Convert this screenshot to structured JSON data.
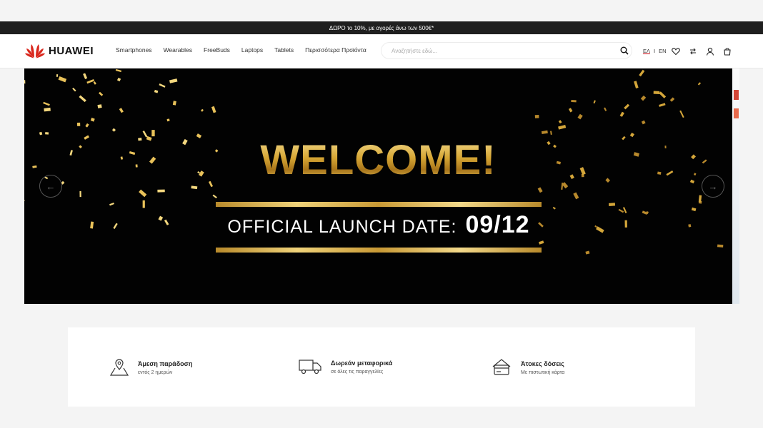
{
  "promo": {
    "text": "ΔΩΡΟ το 10%, με αγορές άνω των 500€*"
  },
  "header": {
    "brand": "HUAWEI",
    "nav": [
      "Smartphones",
      "Wearables",
      "FreeBuds",
      "Laptops",
      "Tablets",
      "Περισσότερα Προϊόντα"
    ],
    "search_placeholder": "Αναζητήστε εδώ...",
    "lang_el": "ΕΛ",
    "lang_sep": "I",
    "lang_en": "EN",
    "accent": "#c7000b"
  },
  "banner": {
    "headline": "WELCOME!",
    "launch_label": "OFFICIAL LAUNCH DATE:",
    "launch_date": "09/12",
    "prev_arrow": "←",
    "next_arrow": "→"
  },
  "features": [
    {
      "icon": "map-pin-icon",
      "title": "Άμεση παράδοση",
      "sub": "εντός 2 ημερών"
    },
    {
      "icon": "truck-icon",
      "title": "Δωρεάν μεταφορικά",
      "sub": "σε όλες τις παραγγελίες"
    },
    {
      "icon": "credit-card-icon",
      "title": "Άτοκες δόσεις",
      "sub": "Με πιστωτική κάρτα"
    }
  ]
}
